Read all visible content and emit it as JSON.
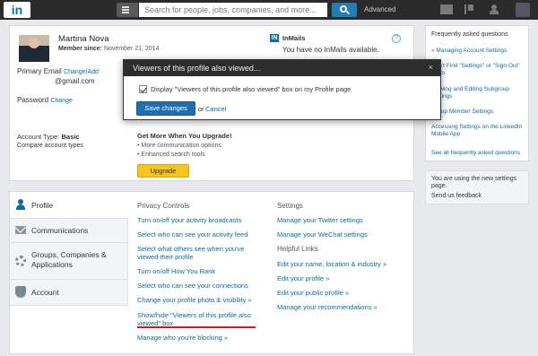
{
  "topbar": {
    "logo": "in",
    "search_placeholder": "Search for people, jobs, companies, and more...",
    "advanced_label": "Advanced"
  },
  "profile": {
    "name": "Martina Nova",
    "member_since_label": "Member since:",
    "member_since_value": "November 21, 2014",
    "primary_email_label": "Primary Email",
    "change_add_label": "Change/Add",
    "email_value": "@gmail.com",
    "password_label": "Password",
    "password_change": "Change",
    "account_type_label": "Account Type:",
    "account_type_value": "Basic",
    "compare_label": "Compare account types"
  },
  "inmail": {
    "title": "InMails",
    "icon_letters": "IN",
    "text": "You have no InMails available."
  },
  "upgrade": {
    "title": "Get More When You Upgrade!",
    "benefit_1": "• More communication options",
    "benefit_2": "• Enhanced search tools",
    "button_label": "Upgrade"
  },
  "modal": {
    "title": "Viewers of this profile also viewed...",
    "close": "×",
    "checkbox_label": "Display \"Viewers of this profile also viewed\" box on my Profile page",
    "save_label": "Save changes",
    "or_label": "or",
    "cancel_label": "Cancel",
    "checked": true
  },
  "faq": {
    "title": "Frequently asked questions",
    "items": [
      "» Managing Account Settings",
      "Can't Find \"Settings\" or \"Sign Out\" Links",
      "Viewing and Editing Subgroup Settings",
      "Group Member Settings",
      "Accessing Settings on the LinkedIn Mobile App"
    ],
    "see_all": "See all frequently asked questions"
  },
  "new_settings": {
    "text": "You are using the new settings page.",
    "feedback": "Send us feedback"
  },
  "nav": {
    "items": [
      {
        "label": "Profile"
      },
      {
        "label": "Communications"
      },
      {
        "label": "Groups, Companies & Applications"
      },
      {
        "label": "Account"
      }
    ]
  },
  "privacy": {
    "title": "Privacy Controls",
    "links": [
      "Turn on/off your activity broadcasts",
      "Select who can see your activity feed",
      "Select what others see when you've viewed their profile",
      "Turn on/off How You Rank",
      "Select who can see your connections",
      "Change your profile photo & visibility »",
      "Show/hide \"Viewers of this profile also viewed\" box",
      "Manage who you're blocking »"
    ]
  },
  "settings": {
    "title": "Settings",
    "links": [
      "Manage your Twitter settings",
      "Manage your WeChat settings"
    ],
    "helpful_title": "Helpful Links",
    "helpful_links": [
      "Edit your name, location & industry »",
      "Edit your profile »",
      "Edit your public profile »",
      "Manage your recommendations »"
    ]
  }
}
